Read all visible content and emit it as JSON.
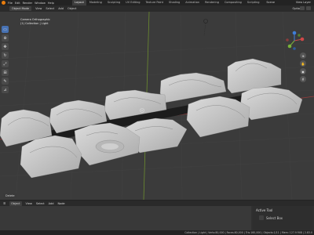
{
  "menu": [
    "File",
    "Edit",
    "Render",
    "Window",
    "Help"
  ],
  "workspace_tabs": [
    "Layout",
    "Modeling",
    "Sculpting",
    "UV Editing",
    "Texture Paint",
    "Shading",
    "Animation",
    "Rendering",
    "Compositing",
    "Scripting"
  ],
  "active_tab": "Layout",
  "scene_name": "Scene",
  "view_layer": "View Layer",
  "viewport_header": {
    "mode": "Object Mode",
    "menus": [
      "View",
      "Select",
      "Add",
      "Object"
    ],
    "options": "Options"
  },
  "viewport": {
    "view_name": "Camera Orthographic",
    "collection_info": "(1) Collection | Light"
  },
  "last_operator": "Delete",
  "timeline": {
    "mode": "Object",
    "menus": [
      "View",
      "Select",
      "Add",
      "Node"
    ]
  },
  "active_tool_panel": {
    "title": "Active Tool",
    "tool": "Select Box"
  },
  "status_bar": {
    "stats": "Collection | Light | Verts:80,000 | Faces:80,000 | Tris:160,000 | Objects:1/11 | Mem: 127.9 MiB | 2.83.0"
  },
  "colors": {
    "accent": "#e87d0d",
    "active_tool": "#4772b3",
    "terrain": "#c9c9c9",
    "grid_x": "#9a3c3c",
    "grid_y": "#6c8c2f"
  }
}
